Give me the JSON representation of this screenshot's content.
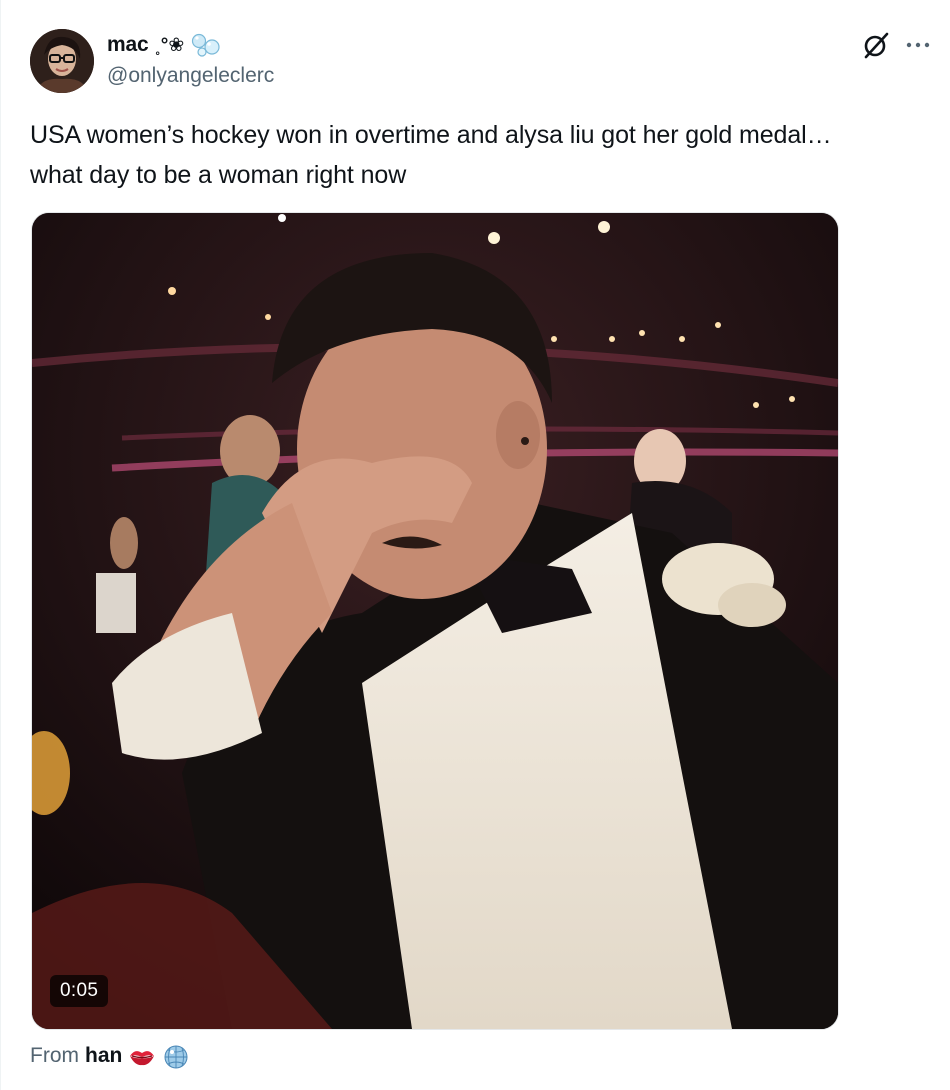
{
  "tweet": {
    "author": {
      "display_name": "mac",
      "name_decoration": "˳°❀",
      "handle": "@onlyangeleclerc",
      "avatar_icon": "avatar-image"
    },
    "text": "USA women’s hockey won in overtime and alysa liu got her gold medal…\nwhat day to be a woman right now",
    "media": {
      "type": "video",
      "duration": "0:05"
    },
    "from": {
      "prefix": "From",
      "name": "han",
      "icons": [
        "kiss-mark-icon",
        "disco-ball-icon"
      ]
    }
  },
  "icons": {
    "grok": "grok-icon",
    "more": "more-options-icon",
    "bubbles": "bubbles-icon"
  },
  "colors": {
    "text_primary": "#0f1419",
    "text_secondary": "#536471",
    "background": "#ffffff",
    "duration_badge": "#000000"
  }
}
